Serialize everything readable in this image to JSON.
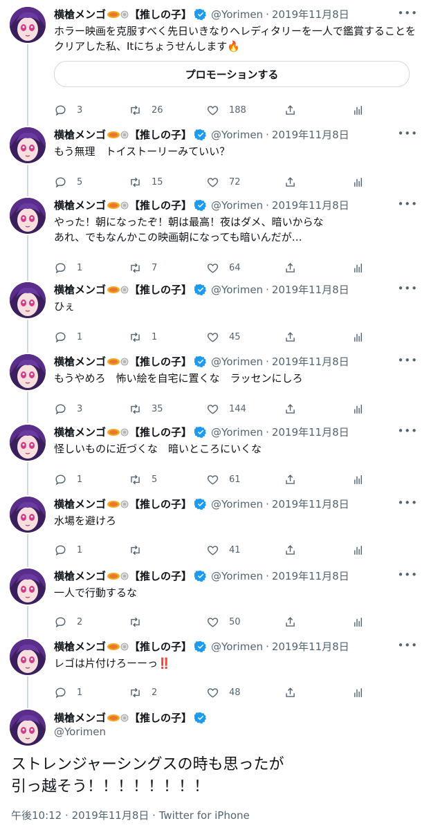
{
  "author": {
    "name": "横槍メンゴ",
    "affiliation": "【推しの子】",
    "handle": "@Yorimen",
    "date": "2019年11月8日",
    "colors": {
      "verified": "#1d9bf0",
      "text_secondary": "#536471"
    }
  },
  "icons": {
    "verified": "verified-badge-icon",
    "reply": "reply-icon",
    "retweet": "retweet-icon",
    "like": "heart-icon",
    "share": "share-icon",
    "analytics": "analytics-icon",
    "more": "more-icon"
  },
  "promo_button": "プロモーションする",
  "tweets": [
    {
      "text": "ホラー映画を克服すべく先日いきなりヘレディタリーを一人で鑑賞することをクリアした私、Itにちょうせんします🔥",
      "replies": "3",
      "retweets": "26",
      "likes": "188"
    },
    {
      "text": "もう無理　トイストーリーみていい？",
      "replies": "5",
      "retweets": "15",
      "likes": "72"
    },
    {
      "text": "やった！朝になったぞ！朝は最高！夜はダメ、暗いからな\nあれ、でもなんかこの映画朝になっても暗いんだが…",
      "replies": "1",
      "retweets": "7",
      "likes": "64"
    },
    {
      "text": "ひぇ",
      "replies": "1",
      "retweets": "1",
      "likes": "45"
    },
    {
      "text": "もうやめろ　怖い絵を自宅に置くな　ラッセンにしろ",
      "replies": "3",
      "retweets": "35",
      "likes": "144"
    },
    {
      "text": "怪しいものに近づくな　暗いところにいくな",
      "replies": "1",
      "retweets": "5",
      "likes": "61"
    },
    {
      "text": "水場を避けろ",
      "replies": "1",
      "retweets": "",
      "likes": "41"
    },
    {
      "text": "一人で行動するな",
      "replies": "2",
      "retweets": "",
      "likes": "50"
    },
    {
      "text": "レゴは片付けろーーっ‼️",
      "replies": "1",
      "retweets": "2",
      "likes": "48"
    }
  ],
  "main_tweet": {
    "text": "ストレンジャーシングスの時も思ったが\n引っ越そう！！！！！！！！",
    "time": "午後10:12",
    "date": "2019年11月8日",
    "source": "Twitter for iPhone"
  }
}
